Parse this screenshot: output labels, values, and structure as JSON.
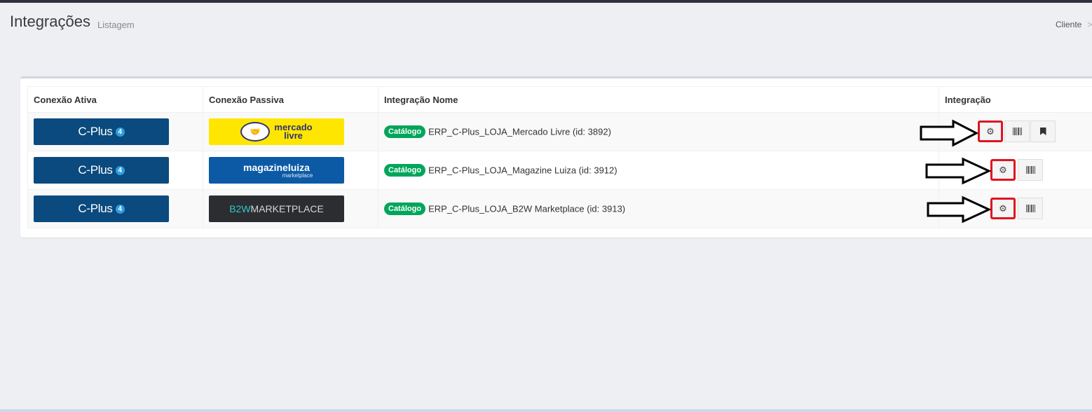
{
  "page": {
    "title": "Integrações",
    "subtitle": "Listagem",
    "breadcrumb": "Cliente",
    "breadcrumb_sep": ">"
  },
  "table": {
    "headers": [
      "Conexão Ativa",
      "Conexão Passiva",
      "Integração Nome",
      "Integração"
    ],
    "rows": [
      {
        "active_logo": "C-Plus",
        "active_logo_num": "4",
        "passive_logo": "mercado livre",
        "passive_line1": "mercado",
        "passive_line2": "livre",
        "badge": "Catálogo",
        "name": "ERP_C-Plus_LOJA_Mercado Livre (id: 3892)",
        "buttons": [
          "gear-icon",
          "barcode-icon",
          "bookmark-icon"
        ]
      },
      {
        "active_logo": "C-Plus",
        "active_logo_num": "4",
        "passive_logo": "magazineluiza marketplace",
        "passive_line1": "magazineluiza",
        "passive_line2": "marketplace",
        "badge": "Catálogo",
        "name": "ERP_C-Plus_LOJA_Magazine Luiza (id: 3912)",
        "buttons": [
          "gear-icon",
          "barcode-icon"
        ]
      },
      {
        "active_logo": "C-Plus",
        "active_logo_num": "4",
        "passive_logo": "B2WMARKETPLACE",
        "passive_line1": "B2W",
        "passive_line2": "MARKETPLACE",
        "badge": "Catálogo",
        "name": "ERP_C-Plus_LOJA_B2W Marketplace (id: 3913)",
        "buttons": [
          "gear-icon",
          "barcode-icon"
        ]
      }
    ]
  },
  "colors": {
    "badge_green": "#00a65a",
    "cplus_blue": "#0a4a7e",
    "mercado_yellow": "#ffe600",
    "magalu_blue": "#0c5aa6",
    "b2w_dark": "#2b2d31",
    "highlight_red": "#e0141f"
  }
}
